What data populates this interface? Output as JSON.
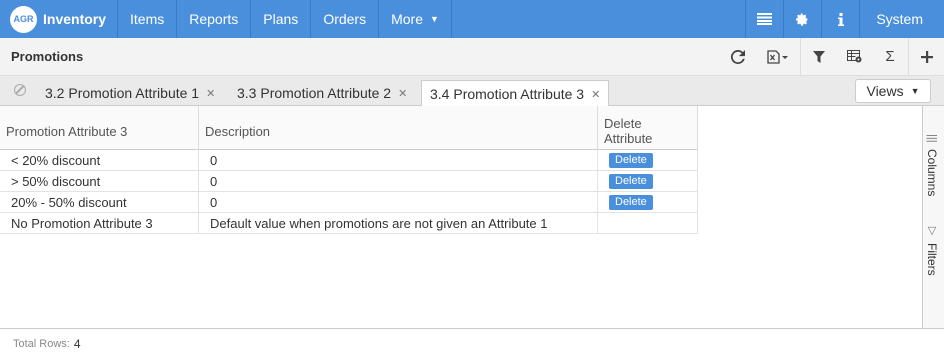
{
  "nav": {
    "logo": "AGR",
    "brand": "Inventory",
    "items": [
      "Items",
      "Reports",
      "Plans",
      "Orders"
    ],
    "more": "More",
    "system": "System"
  },
  "title": "Promotions",
  "tabs": [
    {
      "label": "3.2 Promotion Attribute 1"
    },
    {
      "label": "3.3 Promotion Attribute 2"
    },
    {
      "label": "3.4 Promotion Attribute 3"
    }
  ],
  "views_label": "Views",
  "grid": {
    "headers": {
      "col1": "Promotion Attribute 3",
      "col2": "Description",
      "col3_line1": "Delete",
      "col3_line2": "Attribute"
    },
    "rows": [
      {
        "attr": "< 20% discount",
        "desc": "0",
        "action": "Delete"
      },
      {
        "attr": "> 50% discount",
        "desc": "0",
        "action": "Delete"
      },
      {
        "attr": "20% - 50% discount",
        "desc": "0",
        "action": "Delete"
      },
      {
        "attr": "No Promotion Attribute 3",
        "desc": "Default value when promotions are not given an Attribute 1",
        "action": ""
      }
    ]
  },
  "side": {
    "columns": "Columns",
    "filters": "Filters"
  },
  "footer": {
    "label": "Total Rows:",
    "count": "4"
  }
}
